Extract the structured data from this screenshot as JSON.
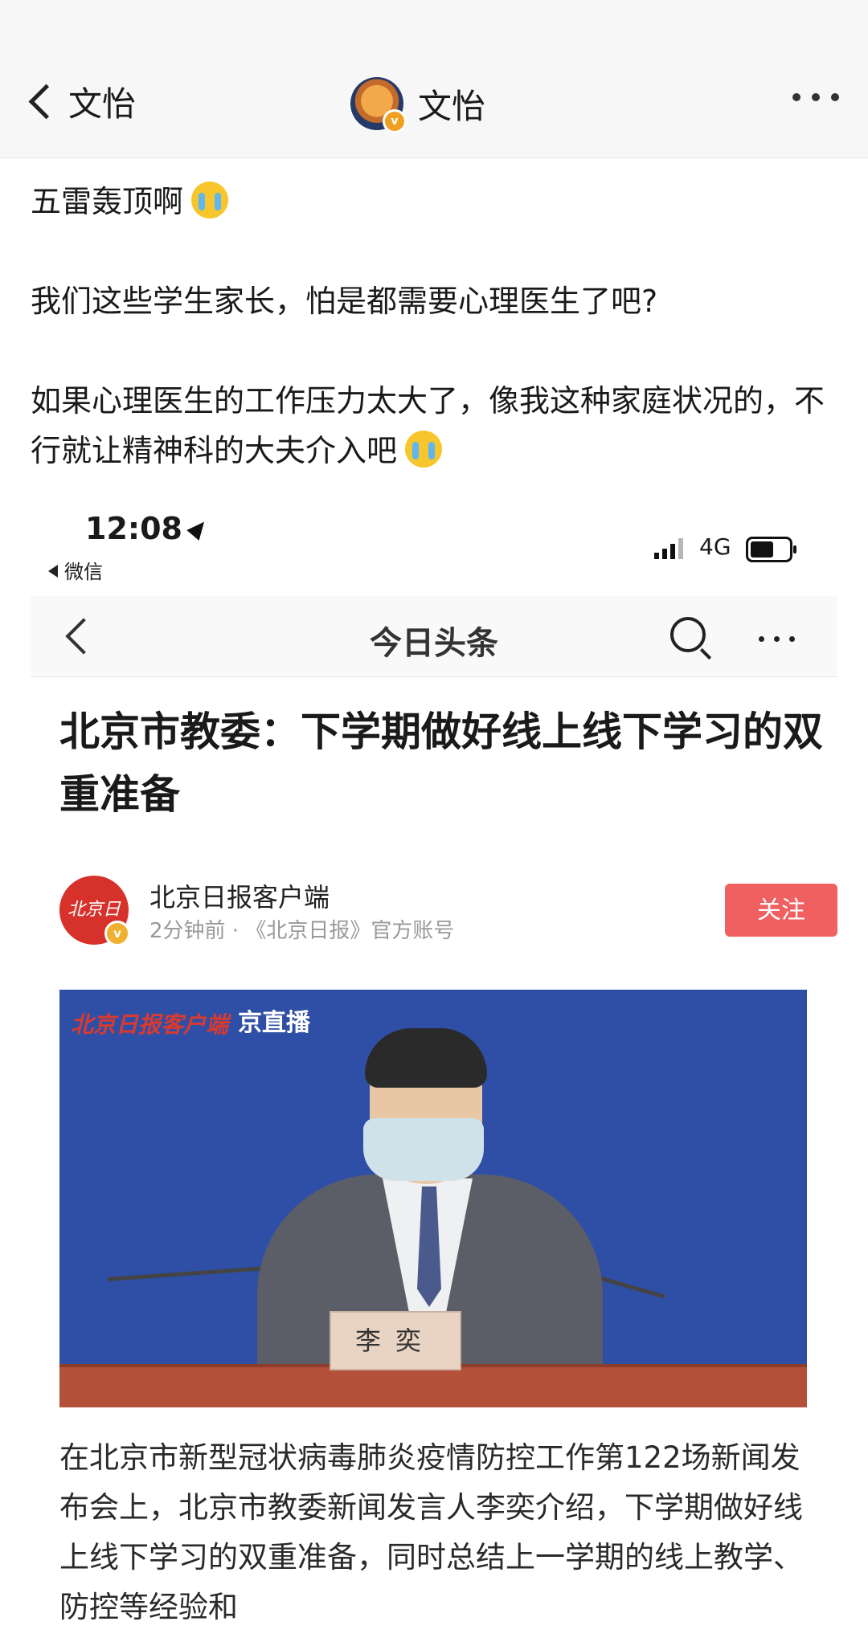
{
  "topbar": {
    "back_label": "文怡",
    "title": "文怡",
    "more_icon": "more-dots-icon"
  },
  "post": {
    "line1": "五雷轰顶啊",
    "line2": "我们这些学生家长，怕是都需要心理医生了吧?",
    "line3": "如果心理医生的工作压力太大了，像我这种家庭状况的，不行就让精神科的大夫介入吧",
    "emoji": "crying-emoji-icon"
  },
  "screenshot": {
    "status": {
      "time": "12:08",
      "back_app": "微信",
      "network": "4G",
      "battery_level": 0.6
    },
    "nav": {
      "title": "今日头条"
    },
    "article": {
      "headline": "北京市教委：下学期做好线上线下学习的双重准备",
      "source_name": "北京日报客户端",
      "source_meta": "2分钟前 · 《北京日报》官方账号",
      "source_logo_text": "北京日报",
      "follow_label": "关注",
      "photo_watermark": "北京日报客户端",
      "photo_watermark2": "京直播",
      "nameplate": "李奕",
      "body": "在北京市新型冠状病毒肺炎疫情防控工作第122场新闻发布会上，北京市教委新闻发言人李奕介绍，下学期做好线上线下学习的双重准备，同时总结上一学期的线上教学、防控等经验和"
    }
  },
  "colors": {
    "follow_button": "#f06060",
    "photo_background": "#2f4fa6",
    "topbar_background": "#f8f7f7"
  }
}
